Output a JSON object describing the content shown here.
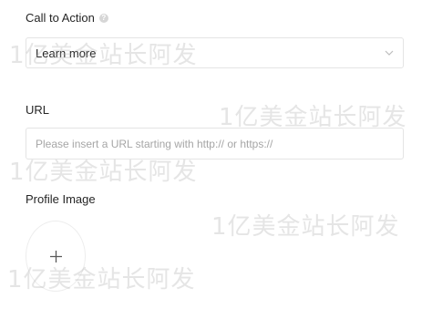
{
  "cta": {
    "label": "Call to Action",
    "info_icon": "info-icon",
    "selected": "Learn more",
    "chevron_icon": "chevron-down-icon"
  },
  "url": {
    "label": "URL",
    "placeholder": "Please insert a URL starting with http:// or https://",
    "value": ""
  },
  "profile": {
    "label": "Profile Image",
    "add_icon": "plus-icon"
  },
  "watermark": {
    "text": "1亿美金站长阿发"
  }
}
